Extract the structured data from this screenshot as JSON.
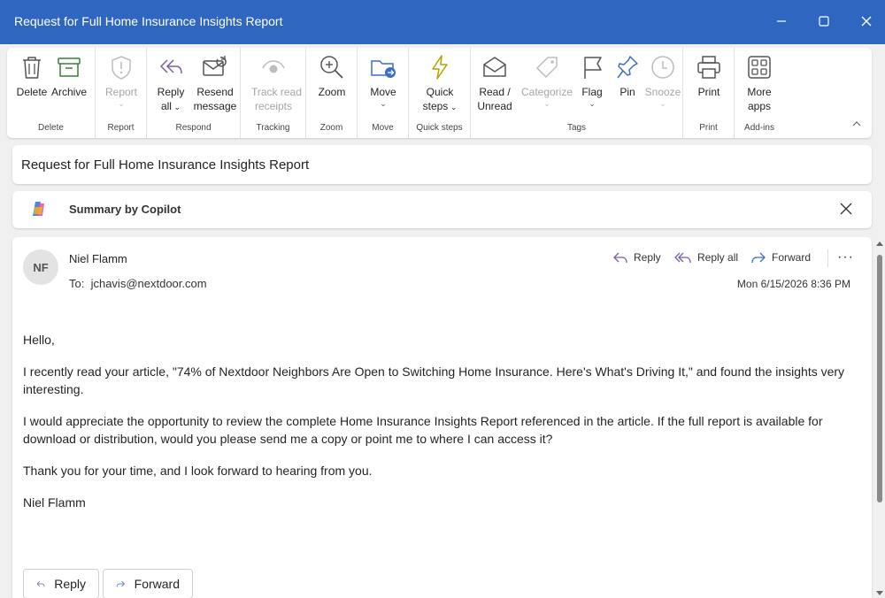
{
  "window": {
    "title": "Request for Full Home Insurance Insights Report"
  },
  "ribbon": {
    "groups": {
      "delete": "Delete",
      "report": "Report",
      "respond": "Respond",
      "tracking": "Tracking",
      "zoom": "Zoom",
      "move": "Move",
      "quick_steps": "Quick steps",
      "tags": "Tags",
      "print": "Print",
      "addins": "Add-ins"
    },
    "buttons": {
      "delete": "Delete",
      "archive": "Archive",
      "report": "Report",
      "reply_all_1": "Reply",
      "reply_all_2": "all",
      "resend_1": "Resend",
      "resend_2": "message",
      "track_1": "Track read",
      "track_2": "receipts",
      "zoom": "Zoom",
      "move": "Move",
      "quick_1": "Quick",
      "quick_2": "steps",
      "read_1": "Read /",
      "read_2": "Unread",
      "categorize": "Categorize",
      "flag": "Flag",
      "pin": "Pin",
      "snooze": "Snooze",
      "print": "Print",
      "more_1": "More",
      "more_2": "apps"
    }
  },
  "subject": "Request for Full Home Insurance Insights Report",
  "copilot": {
    "label": "Summary by Copilot"
  },
  "message": {
    "avatar_initials": "NF",
    "sender": "Niel Flamm",
    "to_label": "To:",
    "to_address": "jchavis@nextdoor.com",
    "date": "Mon 6/15/2026 8:36 PM",
    "actions": {
      "reply": "Reply",
      "reply_all": "Reply all",
      "forward": "Forward",
      "more": "···"
    },
    "body": [
      "Hello,",
      "I recently read your article, \"74% of Nextdoor Neighbors Are Open to Switching Home Insurance. Here's What's Driving It,\" and found the insights very interesting.",
      "I would appreciate the opportunity to review the complete Home Insurance Insights Report referenced in the article. If the full report is available for download or distribution, would you please send me a copy or point me to where I can access it?",
      "Thank you for your time, and I look forward to hearing from you.",
      "Niel Flamm"
    ],
    "bottom_reply": "Reply",
    "bottom_forward": "Forward"
  },
  "colors": {
    "titlebar": "#2f66c0",
    "accent": "#2f66c0"
  }
}
